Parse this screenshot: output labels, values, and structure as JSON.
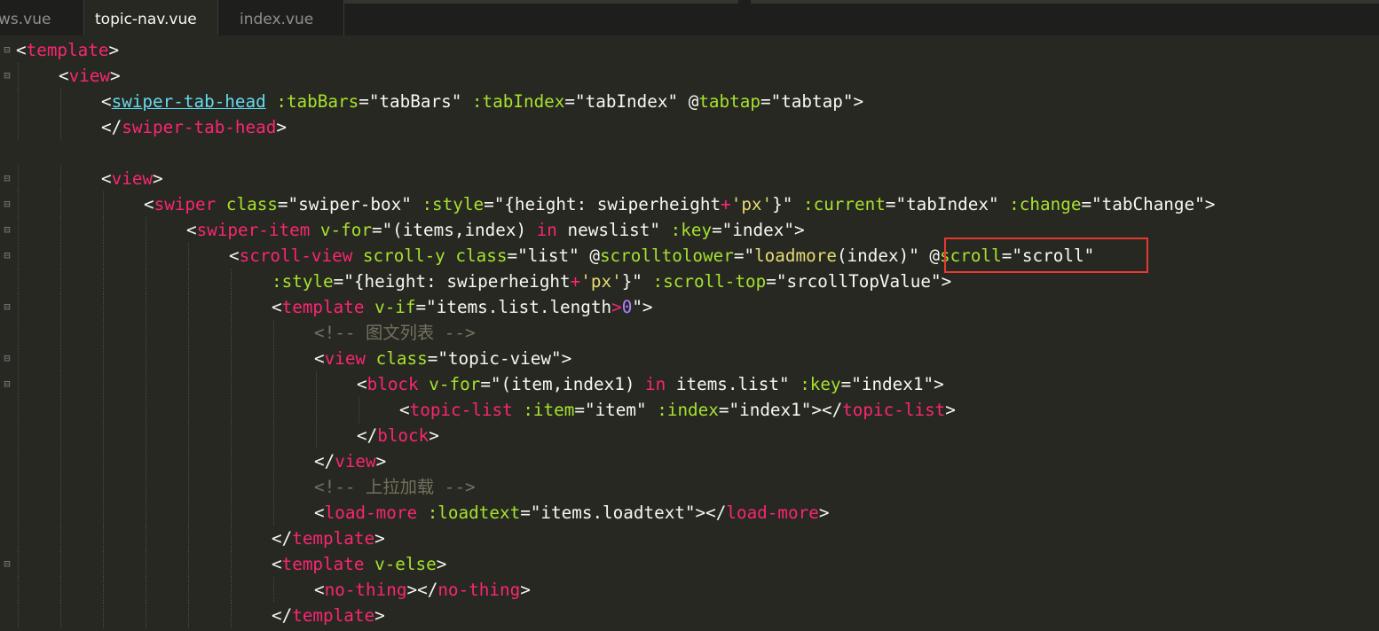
{
  "tabs": [
    {
      "label": "ws.vue",
      "active": false
    },
    {
      "label": "topic-nav.vue",
      "active": true
    },
    {
      "label": "index.vue",
      "active": false
    }
  ],
  "editor": {
    "lines": [
      {
        "indent": 0,
        "fold": "⊟",
        "segments": [
          [
            "punct",
            "<"
          ],
          [
            "tag",
            "template"
          ],
          [
            "punct",
            ">"
          ]
        ]
      },
      {
        "indent": 1,
        "fold": "⊟",
        "segments": [
          [
            "punct",
            "<"
          ],
          [
            "tag",
            "view"
          ],
          [
            "punct",
            ">"
          ]
        ]
      },
      {
        "indent": 2,
        "fold": "",
        "segments": [
          [
            "punct",
            "<"
          ],
          [
            "ul",
            "swiper-tab-head"
          ],
          [
            "punct",
            " "
          ],
          [
            "attr",
            ":tabBars"
          ],
          [
            "punct",
            "="
          ],
          [
            "punct",
            "\"tabBars\""
          ],
          [
            "punct",
            " "
          ],
          [
            "attr",
            ":tabIndex"
          ],
          [
            "punct",
            "="
          ],
          [
            "punct",
            "\"tabIndex\""
          ],
          [
            "punct",
            " @"
          ],
          [
            "attr",
            "tabtap"
          ],
          [
            "punct",
            "="
          ],
          [
            "punct",
            "\"tabtap\""
          ],
          [
            "punct",
            ">"
          ]
        ]
      },
      {
        "indent": 2,
        "fold": "",
        "segments": [
          [
            "punct",
            "</"
          ],
          [
            "tag",
            "swiper-tab-head"
          ],
          [
            "punct",
            ">"
          ]
        ]
      },
      {
        "indent": 0,
        "fold": "",
        "segments": []
      },
      {
        "indent": 2,
        "fold": "⊟",
        "segments": [
          [
            "punct",
            "<"
          ],
          [
            "tag",
            "view"
          ],
          [
            "punct",
            ">"
          ]
        ]
      },
      {
        "indent": 3,
        "fold": "⊟",
        "segments": [
          [
            "punct",
            "<"
          ],
          [
            "tag",
            "swiper"
          ],
          [
            "punct",
            " "
          ],
          [
            "attr",
            "class"
          ],
          [
            "punct",
            "="
          ],
          [
            "punct",
            "\"swiper-box\""
          ],
          [
            "punct",
            " "
          ],
          [
            "attr",
            ":style"
          ],
          [
            "punct",
            "="
          ],
          [
            "punct",
            "\"{height: swiperheight"
          ],
          [
            "op",
            "+"
          ],
          [
            "str",
            "'px'"
          ],
          [
            "punct",
            "}\""
          ],
          [
            "punct",
            " "
          ],
          [
            "attr",
            ":current"
          ],
          [
            "punct",
            "="
          ],
          [
            "punct",
            "\"tabIndex\""
          ],
          [
            "punct",
            " "
          ],
          [
            "attr",
            ":change"
          ],
          [
            "punct",
            "="
          ],
          [
            "punct",
            "\"tabChange\""
          ],
          [
            "punct",
            ">"
          ]
        ]
      },
      {
        "indent": 4,
        "fold": "⊟",
        "segments": [
          [
            "punct",
            "<"
          ],
          [
            "tag",
            "swiper-item"
          ],
          [
            "punct",
            " "
          ],
          [
            "attr",
            "v-for"
          ],
          [
            "punct",
            "="
          ],
          [
            "punct",
            "\"(items,index) "
          ],
          [
            "op",
            "in"
          ],
          [
            "punct",
            " newslist\""
          ],
          [
            "punct",
            " "
          ],
          [
            "attr",
            ":key"
          ],
          [
            "punct",
            "="
          ],
          [
            "punct",
            "\"index\""
          ],
          [
            "punct",
            ">"
          ]
        ]
      },
      {
        "indent": 5,
        "fold": "⊟",
        "segments": [
          [
            "punct",
            "<"
          ],
          [
            "tag",
            "scroll-view"
          ],
          [
            "punct",
            " "
          ],
          [
            "attr",
            "scroll-y"
          ],
          [
            "punct",
            " "
          ],
          [
            "attr",
            "class"
          ],
          [
            "punct",
            "="
          ],
          [
            "punct",
            "\"list\""
          ],
          [
            "punct",
            " @"
          ],
          [
            "attr",
            "scrolltolower"
          ],
          [
            "punct",
            "="
          ],
          [
            "punct",
            "\""
          ],
          [
            "str",
            "loadmore"
          ],
          [
            "punct",
            "(index)\""
          ],
          [
            "punct",
            " @"
          ],
          [
            "attr",
            "scroll"
          ],
          [
            "punct",
            "="
          ],
          [
            "punct",
            "\"scroll\""
          ]
        ]
      },
      {
        "indent": 6,
        "fold": "",
        "segments": [
          [
            "attr",
            ":style"
          ],
          [
            "punct",
            "="
          ],
          [
            "punct",
            "\"{height: swiperheight"
          ],
          [
            "op",
            "+"
          ],
          [
            "str",
            "'px'"
          ],
          [
            "punct",
            "}\""
          ],
          [
            "punct",
            " "
          ],
          [
            "attr",
            ":scroll-top"
          ],
          [
            "punct",
            "="
          ],
          [
            "punct",
            "\"srcollTopValue\""
          ],
          [
            "punct",
            ">"
          ]
        ]
      },
      {
        "indent": 6,
        "fold": "⊟",
        "segments": [
          [
            "punct",
            "<"
          ],
          [
            "tag",
            "template"
          ],
          [
            "punct",
            " "
          ],
          [
            "attr",
            "v-if"
          ],
          [
            "punct",
            "="
          ],
          [
            "punct",
            "\"items.list.length"
          ],
          [
            "op",
            ">"
          ],
          [
            "num",
            "0"
          ],
          [
            "punct",
            "\""
          ],
          [
            "punct",
            ">"
          ]
        ]
      },
      {
        "indent": 7,
        "fold": "",
        "segments": [
          [
            "cmt",
            "<!-- 图文列表 -->"
          ]
        ]
      },
      {
        "indent": 7,
        "fold": "⊟",
        "segments": [
          [
            "punct",
            "<"
          ],
          [
            "tag",
            "view"
          ],
          [
            "punct",
            " "
          ],
          [
            "attr",
            "class"
          ],
          [
            "punct",
            "="
          ],
          [
            "punct",
            "\"topic-view\""
          ],
          [
            "punct",
            ">"
          ]
        ]
      },
      {
        "indent": 8,
        "fold": "⊟",
        "segments": [
          [
            "punct",
            "<"
          ],
          [
            "tag",
            "block"
          ],
          [
            "punct",
            " "
          ],
          [
            "attr",
            "v-for"
          ],
          [
            "punct",
            "="
          ],
          [
            "punct",
            "\"(item,index1) "
          ],
          [
            "op",
            "in"
          ],
          [
            "punct",
            " items.list\""
          ],
          [
            "punct",
            " "
          ],
          [
            "attr",
            ":key"
          ],
          [
            "punct",
            "="
          ],
          [
            "punct",
            "\"index1\""
          ],
          [
            "punct",
            ">"
          ]
        ]
      },
      {
        "indent": 9,
        "fold": "",
        "segments": [
          [
            "punct",
            "<"
          ],
          [
            "tag",
            "topic-list"
          ],
          [
            "punct",
            " "
          ],
          [
            "attr",
            ":item"
          ],
          [
            "punct",
            "="
          ],
          [
            "punct",
            "\"item\""
          ],
          [
            "punct",
            " "
          ],
          [
            "attr",
            ":index"
          ],
          [
            "punct",
            "="
          ],
          [
            "punct",
            "\"index1\""
          ],
          [
            "punct",
            "></"
          ],
          [
            "tag",
            "topic-list"
          ],
          [
            "punct",
            ">"
          ]
        ]
      },
      {
        "indent": 8,
        "fold": "",
        "segments": [
          [
            "punct",
            "</"
          ],
          [
            "tag",
            "block"
          ],
          [
            "punct",
            ">"
          ]
        ]
      },
      {
        "indent": 7,
        "fold": "",
        "segments": [
          [
            "punct",
            "</"
          ],
          [
            "tag",
            "view"
          ],
          [
            "punct",
            ">"
          ]
        ]
      },
      {
        "indent": 7,
        "fold": "",
        "segments": [
          [
            "cmt",
            "<!-- 上拉加载 -->"
          ]
        ]
      },
      {
        "indent": 7,
        "fold": "",
        "segments": [
          [
            "punct",
            "<"
          ],
          [
            "tag",
            "load-more"
          ],
          [
            "punct",
            " "
          ],
          [
            "attr",
            ":loadtext"
          ],
          [
            "punct",
            "="
          ],
          [
            "punct",
            "\"items.loadtext\""
          ],
          [
            "punct",
            "></"
          ],
          [
            "tag",
            "load-more"
          ],
          [
            "punct",
            ">"
          ]
        ]
      },
      {
        "indent": 6,
        "fold": "",
        "segments": [
          [
            "punct",
            "</"
          ],
          [
            "tag",
            "template"
          ],
          [
            "punct",
            ">"
          ]
        ]
      },
      {
        "indent": 6,
        "fold": "⊟",
        "segments": [
          [
            "punct",
            "<"
          ],
          [
            "tag",
            "template"
          ],
          [
            "punct",
            " "
          ],
          [
            "attr",
            "v-else"
          ],
          [
            "punct",
            ">"
          ]
        ]
      },
      {
        "indent": 7,
        "fold": "",
        "segments": [
          [
            "punct",
            "<"
          ],
          [
            "tag",
            "no-thing"
          ],
          [
            "punct",
            "></"
          ],
          [
            "tag",
            "no-thing"
          ],
          [
            "punct",
            ">"
          ]
        ]
      },
      {
        "indent": 6,
        "fold": "",
        "segments": [
          [
            "punct",
            "</"
          ],
          [
            "tag",
            "template"
          ],
          [
            "punct",
            ">"
          ]
        ]
      }
    ]
  },
  "colors": {
    "background": "#272822",
    "tag": "#f92672",
    "attribute": "#a6e22e",
    "string": "#e6db74",
    "comment": "#75715e",
    "number": "#ae81ff",
    "highlight_box": "#e53a32"
  }
}
